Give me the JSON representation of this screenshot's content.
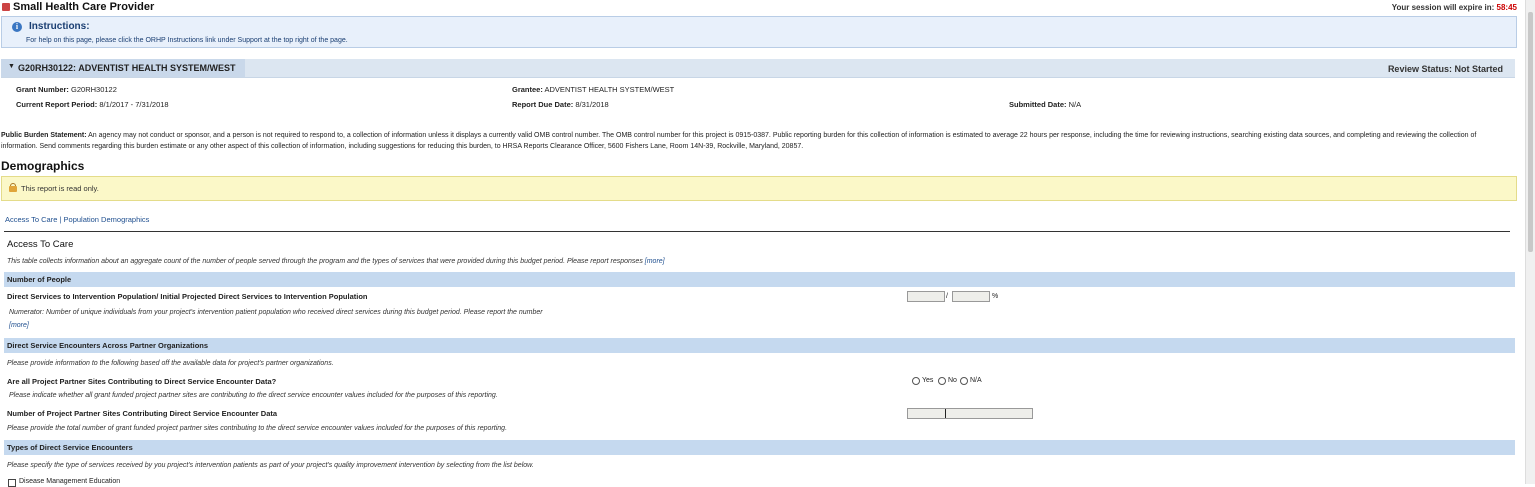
{
  "app": {
    "title": "Small Health Care Provider",
    "session_label": "Your session will expire in:",
    "session_timer": "58:45"
  },
  "instructions": {
    "title": "Instructions:",
    "text": "For help on this page, please click the ORHP Instructions link under Support at the top right of the page."
  },
  "grant": {
    "title": "G20RH30122: ADVENTIST HEALTH SYSTEM/WEST",
    "review_status_label": "Review Status:",
    "review_status_value": "Not Started",
    "grant_number_label": "Grant Number:",
    "grant_number_value": "G20RH30122",
    "grantee_label": "Grantee:",
    "grantee_value": "ADVENTIST HEALTH SYSTEM/WEST",
    "period_label": "Current Report Period:",
    "period_value": "8/1/2017 - 7/31/2018",
    "due_label": "Report Due Date:",
    "due_value": "8/31/2018",
    "submitted_label": "Submitted Date:",
    "submitted_value": "N/A"
  },
  "burden": {
    "label": "Public Burden Statement:",
    "text": "An agency may not conduct or sponsor, and a person is not required to respond to, a collection of information unless it displays a currently valid OMB control number. The OMB control number for this project is 0915-0387. Public reporting burden for this collection of information is estimated to average 22 hours per response, including the time for reviewing instructions, searching existing data sources, and completing and reviewing the collection of information. Send comments regarding this burden estimate or any other aspect of this collection of information, including suggestions for reducing this burden, to HRSA Reports Clearance Officer, 5600 Fishers Lane, Room 14N-39, Rockville, Maryland, 20857."
  },
  "section": {
    "title": "Demographics",
    "readonly_text": "This report is read only."
  },
  "nav_links": {
    "access": "Access To Care",
    "separator": "|",
    "population": "Population Demographics"
  },
  "access": {
    "title": "Access To Care",
    "desc": "This table collects information about an aggregate count of the number of people served through the program and the types of services that were provided during this budget period. Please report responses",
    "more": "[more]"
  },
  "num_people": {
    "band": "Number of People",
    "question": "Direct Services to Intervention Population/ Initial Projected Direct Services to Intervention Population",
    "slash": "/",
    "percent": "%",
    "numerator_desc": "Numerator: Number of unique individuals from your project's intervention patient population who received direct services during this budget period.  Please report the number",
    "more": "[more]"
  },
  "encounters": {
    "band": "Direct Service Encounters Across Partner Organizations",
    "desc": "Please provide information to the following based off the available data for project's partner organizations.",
    "q1": "Are all Project Partner Sites Contributing to Direct Service Encounter Data?",
    "q1_options": [
      "Yes",
      "No",
      "N/A"
    ],
    "q1_desc": "Please indicate whether all grant funded project partner sites are contributing to the direct service encounter values included for the purposes of this reporting.",
    "q2": "Number of Project Partner Sites Contributing Direct Service Encounter Data",
    "q2_desc": "Please provide the total number of grant funded project partner sites contributing to the direct service encounter values included for the purposes of this reporting."
  },
  "types": {
    "band": "Types of Direct Service Encounters",
    "desc": "Please specify the type of services received by you project's intervention patients as part of your project's quality improvement intervention by selecting from the list below.",
    "first_option": "Disease Management Education"
  }
}
